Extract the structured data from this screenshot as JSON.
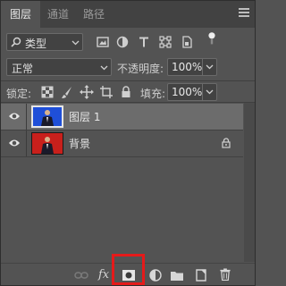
{
  "tabs": [
    {
      "label": "图层",
      "active": true
    },
    {
      "label": "通道",
      "active": false
    },
    {
      "label": "路径",
      "active": false
    }
  ],
  "filter": {
    "kind_label": "类型"
  },
  "blend": {
    "mode": "正常",
    "opacity_label": "不透明度:",
    "opacity_value": "100%"
  },
  "lock": {
    "label": "锁定:",
    "fill_label": "填充:",
    "fill_value": "100%"
  },
  "layers": [
    {
      "name": "图层 1",
      "selected": true,
      "visible": true,
      "locked": false
    },
    {
      "name": "背景",
      "selected": false,
      "visible": true,
      "locked": true
    }
  ],
  "bottom_toolbar": {
    "icons": [
      "link-layers-icon",
      "fx-icon",
      "add-mask-icon",
      "adjustment-layer-icon",
      "group-folder-icon",
      "new-layer-icon",
      "trash-icon"
    ],
    "fx_label": "fx",
    "highlighted": "add-mask-icon"
  },
  "colors": {
    "panel_bg": "#535353",
    "tab_bg": "#424242",
    "selected_row": "#6c6c6c",
    "highlight": "#e51a1a",
    "thumb_blue": "#1f4fd8",
    "thumb_red": "#c8201c"
  }
}
